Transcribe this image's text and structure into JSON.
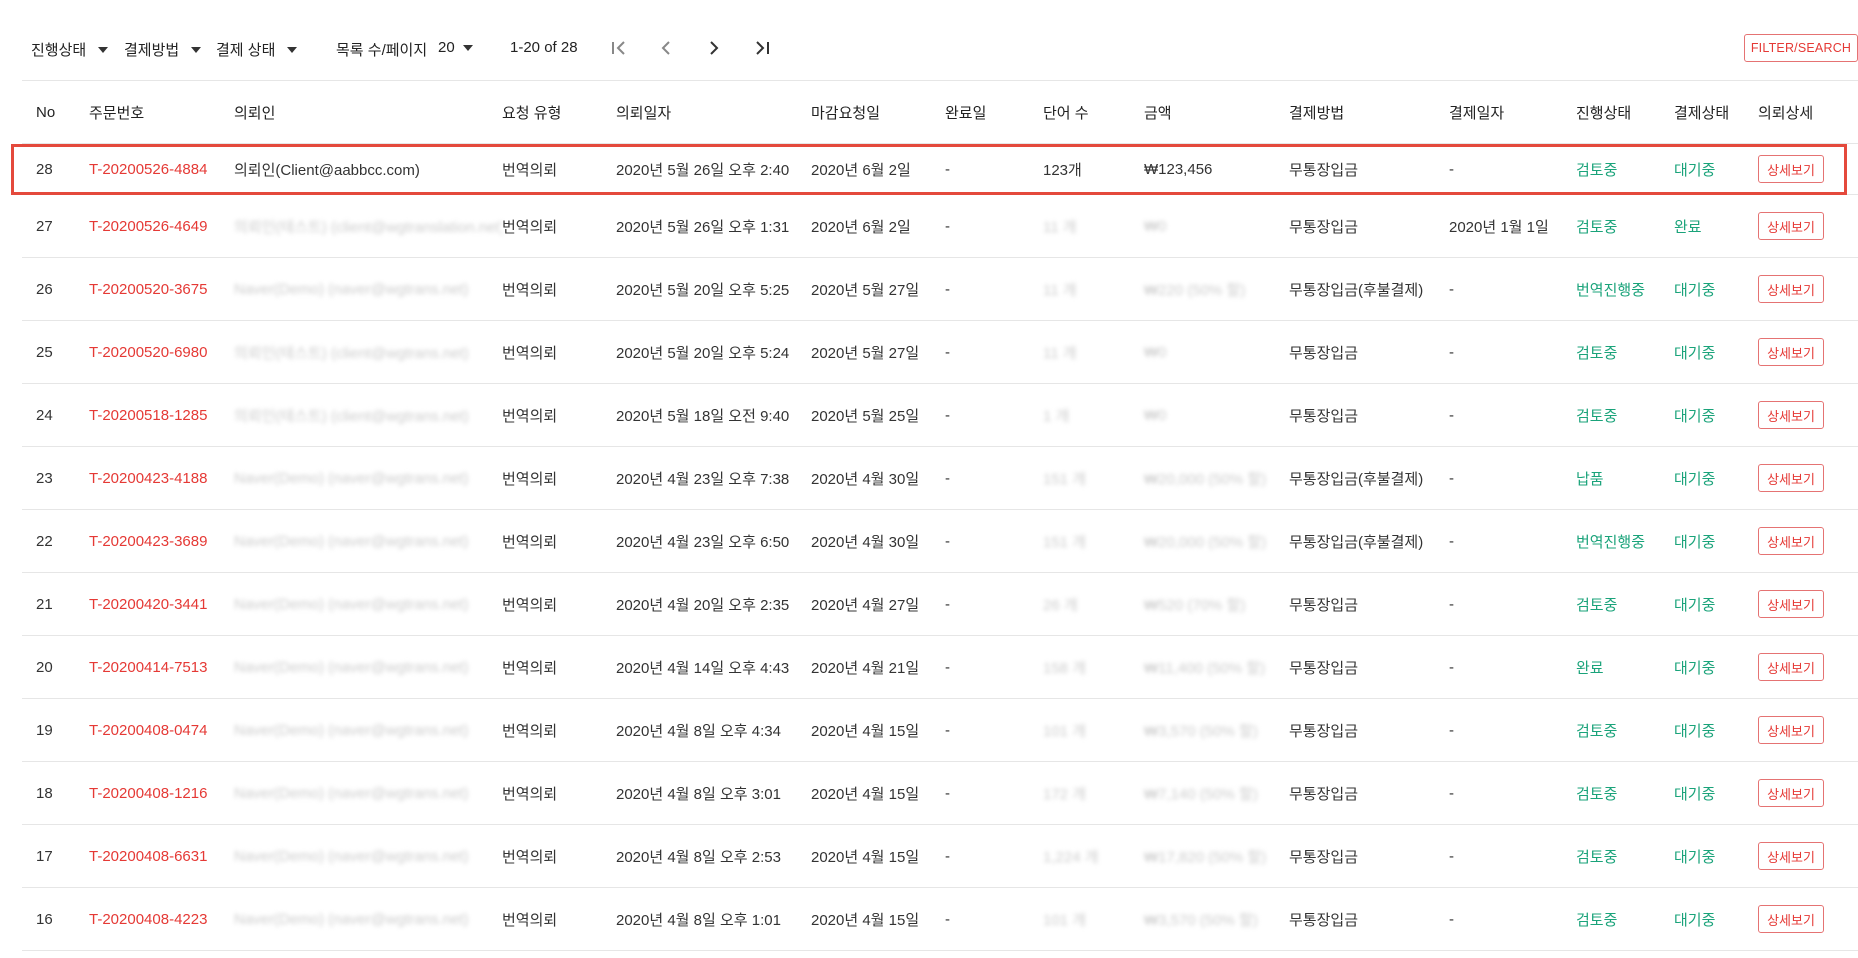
{
  "toolbar": {
    "progress_filter": "진행상태",
    "payment_method_filter": "결제방법",
    "payment_status_filter": "결제 상태",
    "page_size_label": "목록 수/페이지",
    "page_size_value": "20",
    "pagination_text": "1-20 of 28",
    "filter_search_label": "FILTER/SEARCH"
  },
  "table": {
    "headers": [
      "No",
      "주문번호",
      "의뢰인",
      "요청 유형",
      "의뢰일자",
      "마감요청일",
      "완료일",
      "단어 수",
      "금액",
      "결제방법",
      "결제일자",
      "진행상태",
      "결제상태",
      "의뢰상세"
    ],
    "detail_button_label": "상세보기",
    "rows": [
      {
        "no": "28",
        "order": "T-20200526-4884",
        "client": "의뢰인(Client@aabbcc.com)",
        "type": "번역의뢰",
        "req_date": "2020년 5월 26일 오후 2:40",
        "deadline": "2020년 6월 2일",
        "done": "-",
        "words": "123개",
        "amount": "₩123,456",
        "method": "무통장입금",
        "paid": "-",
        "progress": "검토중",
        "pay_status": "대기중"
      },
      {
        "no": "27",
        "order": "T-20200526-4649",
        "client": "의뢰인(테스트) (client@wgtranslation.net)",
        "type": "번역의뢰",
        "req_date": "2020년 5월 26일 오후 1:31",
        "deadline": "2020년 6월 2일",
        "done": "-",
        "words": "11 개",
        "amount": "₩0",
        "method": "무통장입금",
        "paid": "2020년 1월 1일",
        "progress": "검토중",
        "pay_status": "완료"
      },
      {
        "no": "26",
        "order": "T-20200520-3675",
        "client": "Naver(Demo) (naver@wgtrans.net)",
        "type": "번역의뢰",
        "req_date": "2020년 5월 20일 오후 5:25",
        "deadline": "2020년 5월 27일",
        "done": "-",
        "words": "11 개",
        "amount": "₩220 (50% 할)",
        "method": "무통장입금(후불결제)",
        "paid": "-",
        "progress": "번역진행중",
        "pay_status": "대기중"
      },
      {
        "no": "25",
        "order": "T-20200520-6980",
        "client": "의뢰인(테스트) (client@wgtrans.net)",
        "type": "번역의뢰",
        "req_date": "2020년 5월 20일 오후 5:24",
        "deadline": "2020년 5월 27일",
        "done": "-",
        "words": "11 개",
        "amount": "₩0",
        "method": "무통장입금",
        "paid": "-",
        "progress": "검토중",
        "pay_status": "대기중"
      },
      {
        "no": "24",
        "order": "T-20200518-1285",
        "client": "의뢰인(테스트) (client@wgtrans.net)",
        "type": "번역의뢰",
        "req_date": "2020년 5월 18일 오전 9:40",
        "deadline": "2020년 5월 25일",
        "done": "-",
        "words": "1 개",
        "amount": "₩0",
        "method": "무통장입금",
        "paid": "-",
        "progress": "검토중",
        "pay_status": "대기중"
      },
      {
        "no": "23",
        "order": "T-20200423-4188",
        "client": "Naver(Demo) (naver@wgtrans.net)",
        "type": "번역의뢰",
        "req_date": "2020년 4월 23일 오후 7:38",
        "deadline": "2020년 4월 30일",
        "done": "-",
        "words": "151 개",
        "amount": "₩20,000 (50% 할)",
        "method": "무통장입금(후불결제)",
        "paid": "-",
        "progress": "납품",
        "pay_status": "대기중"
      },
      {
        "no": "22",
        "order": "T-20200423-3689",
        "client": "Naver(Demo) (naver@wgtrans.net)",
        "type": "번역의뢰",
        "req_date": "2020년 4월 23일 오후 6:50",
        "deadline": "2020년 4월 30일",
        "done": "-",
        "words": "151 개",
        "amount": "₩20,000 (50% 할)",
        "method": "무통장입금(후불결제)",
        "paid": "-",
        "progress": "번역진행중",
        "pay_status": "대기중"
      },
      {
        "no": "21",
        "order": "T-20200420-3441",
        "client": "Naver(Demo) (naver@wgtrans.net)",
        "type": "번역의뢰",
        "req_date": "2020년 4월 20일 오후 2:35",
        "deadline": "2020년 4월 27일",
        "done": "-",
        "words": "26 개",
        "amount": "₩520 (70% 할)",
        "method": "무통장입금",
        "paid": "-",
        "progress": "검토중",
        "pay_status": "대기중"
      },
      {
        "no": "20",
        "order": "T-20200414-7513",
        "client": "Naver(Demo) (naver@wgtrans.net)",
        "type": "번역의뢰",
        "req_date": "2020년 4월 14일 오후 4:43",
        "deadline": "2020년 4월 21일",
        "done": "-",
        "words": "158 개",
        "amount": "₩11,400 (50% 할)",
        "method": "무통장입금",
        "paid": "-",
        "progress": "완료",
        "pay_status": "대기중"
      },
      {
        "no": "19",
        "order": "T-20200408-0474",
        "client": "Naver(Demo) (naver@wgtrans.net)",
        "type": "번역의뢰",
        "req_date": "2020년 4월 8일 오후 4:34",
        "deadline": "2020년 4월 15일",
        "done": "-",
        "words": "101 개",
        "amount": "₩3,570 (50% 할)",
        "method": "무통장입금",
        "paid": "-",
        "progress": "검토중",
        "pay_status": "대기중"
      },
      {
        "no": "18",
        "order": "T-20200408-1216",
        "client": "Naver(Demo) (naver@wgtrans.net)",
        "type": "번역의뢰",
        "req_date": "2020년 4월 8일 오후 3:01",
        "deadline": "2020년 4월 15일",
        "done": "-",
        "words": "172 개",
        "amount": "₩7,140 (50% 할)",
        "method": "무통장입금",
        "paid": "-",
        "progress": "검토중",
        "pay_status": "대기중"
      },
      {
        "no": "17",
        "order": "T-20200408-6631",
        "client": "Naver(Demo) (naver@wgtrans.net)",
        "type": "번역의뢰",
        "req_date": "2020년 4월 8일 오후 2:53",
        "deadline": "2020년 4월 15일",
        "done": "-",
        "words": "1,224 개",
        "amount": "₩17,820 (50% 할)",
        "method": "무통장입금",
        "paid": "-",
        "progress": "검토중",
        "pay_status": "대기중"
      },
      {
        "no": "16",
        "order": "T-20200408-4223",
        "client": "Naver(Demo) (naver@wgtrans.net)",
        "type": "번역의뢰",
        "req_date": "2020년 4월 8일 오후 1:01",
        "deadline": "2020년 4월 15일",
        "done": "-",
        "words": "101 개",
        "amount": "₩3,570 (50% 할)",
        "method": "무통장입금",
        "paid": "-",
        "progress": "검토중",
        "pay_status": "대기중"
      }
    ]
  },
  "colors": {
    "accent": "#e53935",
    "status_green": "#1aa37a",
    "highlight": "#e4493c"
  }
}
